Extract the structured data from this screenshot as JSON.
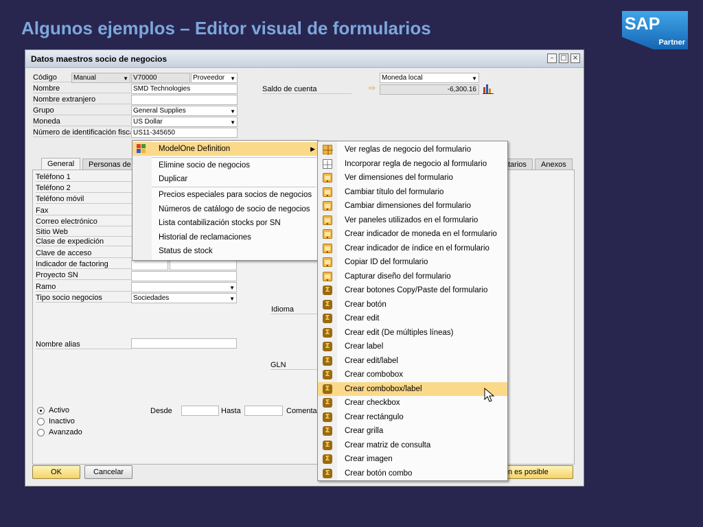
{
  "slide_title": "Algunos ejemplos – Editor visual de formularios",
  "logo": {
    "brand": "SAP",
    "sub": "Partner"
  },
  "window": {
    "title": "Datos maestros socio de negocios",
    "labels": {
      "codigo": "Código",
      "nombre": "Nombre",
      "nombre_ext": "Nombre extranjero",
      "grupo": "Grupo",
      "moneda": "Moneda",
      "nif": "Número de identificación fisca",
      "saldo": "Saldo de cuenta"
    },
    "values": {
      "codigo_mode": "Manual",
      "codigo": "V70000",
      "tipo": "Proveedor",
      "nombre": "SMD Technologies",
      "nombre_ext": "",
      "grupo": "General Supplies",
      "moneda": "US Dollar",
      "nif": "US11-345650",
      "moneda_local": "Moneda local",
      "saldo": "-6,300.16"
    },
    "tabs": [
      "General",
      "Personas de",
      "tarios",
      "Anexos"
    ],
    "general": {
      "telefono1": "Teléfono 1",
      "telefono2": "Teléfono 2",
      "movil": "Teléfono móvil",
      "fax": "Fax",
      "correo": "Correo electrónico",
      "web": "Sitio Web",
      "expedicion": "Clase de expedición",
      "clave": "Clave de acceso",
      "factoring": "Indicador de factoring",
      "proyecto": "Proyecto SN",
      "ramo": "Ramo",
      "tipo_socio": "Tipo socio negocios",
      "tipo_socio_val": "Sociedades",
      "idioma": "Idioma",
      "alias": "Nombre alias",
      "gln": "GLN"
    },
    "status": {
      "activo": "Activo",
      "inactivo": "Inactivo",
      "avanzado": "Avanzado"
    },
    "range": {
      "desde": "Desde",
      "hasta": "Hasta",
      "comentar": "Comentar"
    },
    "buttons": {
      "ok": "OK",
      "cancel": "Cancelar",
      "right": "n es posible"
    }
  },
  "menu1": {
    "header": "ModelOne Definition",
    "items": [
      "Elimine socio de negocios",
      "Duplicar",
      "Precios especiales para socios de negocios",
      "Números de catálogo de socio de negocios",
      "Lista contabilización stocks por SN",
      "Historial de reclamaciones",
      "Status de stock"
    ]
  },
  "menu2": {
    "items": [
      {
        "label": "Ver reglas de negocio del formulario",
        "icon": "rules-grid-icon"
      },
      {
        "label": "Incorporar regla de negocio al formulario",
        "icon": "grid-icon"
      },
      {
        "label": "Ver dimensiones del formulario",
        "icon": "monitor-icon"
      },
      {
        "label": "Cambiar título del formulario",
        "icon": "monitor-icon"
      },
      {
        "label": "Cambiar dimensiones del formulario",
        "icon": "monitor-icon"
      },
      {
        "label": "Ver paneles utilizados en el formulario",
        "icon": "monitor-icon"
      },
      {
        "label": "Crear indicador de moneda en el formulario",
        "icon": "monitor-icon"
      },
      {
        "label": "Crear indicador de índice en el formulario",
        "icon": "monitor-icon"
      },
      {
        "label": "Copiar ID del formulario",
        "icon": "monitor-icon"
      },
      {
        "label": "Capturar diseño del formulario",
        "icon": "monitor-icon"
      },
      {
        "label": "Crear botones Copy/Paste del formulario",
        "icon": "sigma-icon"
      },
      {
        "label": "Crear botón",
        "icon": "sigma-icon"
      },
      {
        "label": "Crear edit",
        "icon": "sigma-icon"
      },
      {
        "label": "Crear edit (De múltiples líneas)",
        "icon": "sigma-icon"
      },
      {
        "label": "Crear label",
        "icon": "sigma-icon"
      },
      {
        "label": "Crear edit/label",
        "icon": "sigma-icon"
      },
      {
        "label": "Crear combobox",
        "icon": "sigma-icon"
      },
      {
        "label": "Crear combobox/label",
        "icon": "sigma-icon"
      },
      {
        "label": "Crear checkbox",
        "icon": "sigma-icon"
      },
      {
        "label": "Crear rectángulo",
        "icon": "sigma-icon"
      },
      {
        "label": "Crear grilla",
        "icon": "sigma-icon"
      },
      {
        "label": "Crear matriz de consulta",
        "icon": "sigma-icon"
      },
      {
        "label": "Crear imagen",
        "icon": "sigma-icon"
      },
      {
        "label": "Crear botón combo",
        "icon": "sigma-icon"
      }
    ],
    "highlighted_index": 17
  }
}
